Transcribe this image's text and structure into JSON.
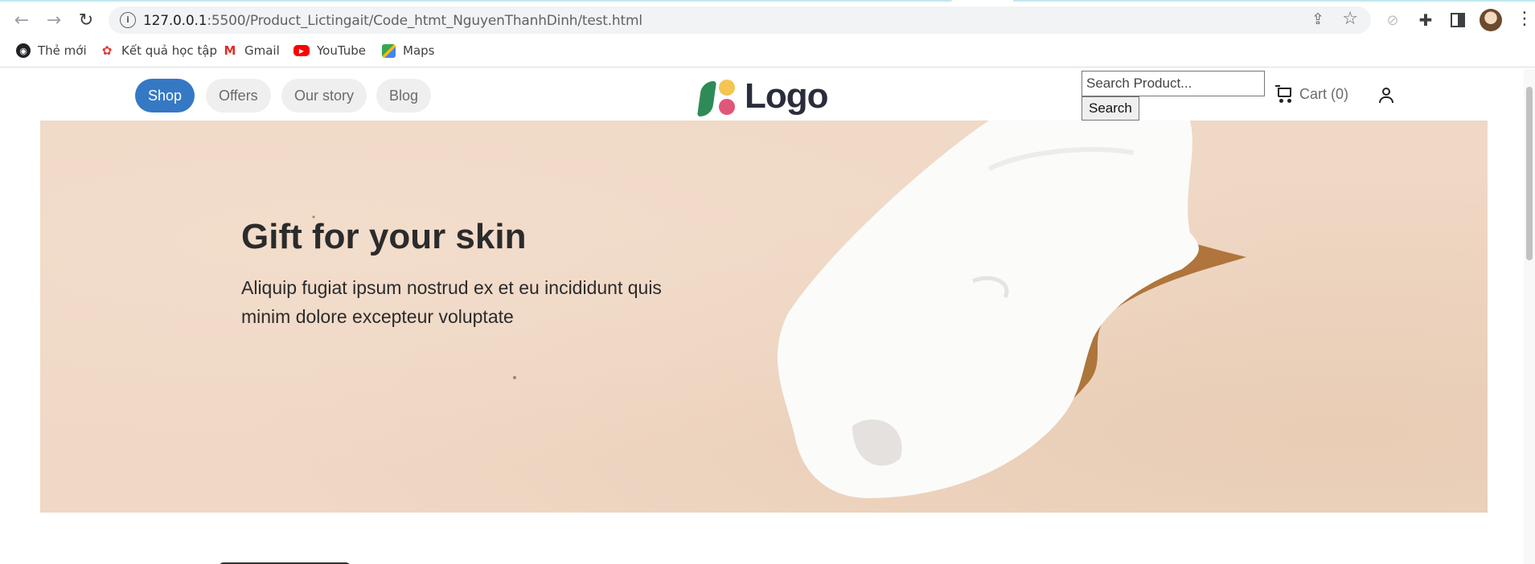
{
  "browser": {
    "url_host": "127.0.0.1",
    "url_rest": ":5500/Product_Lictingait/Code_htmt_NguyenThanhDinh/test.html"
  },
  "bookmarks": [
    {
      "label": "Thẻ mới",
      "icon": "globe-icon"
    },
    {
      "label": "Kết quả học tập",
      "icon": "school-logo-icon"
    },
    {
      "label": "Gmail",
      "icon": "gmail-icon"
    },
    {
      "label": "YouTube",
      "icon": "youtube-icon"
    },
    {
      "label": "Maps",
      "icon": "maps-icon"
    }
  ],
  "header": {
    "nav": [
      {
        "label": "Shop",
        "active": true
      },
      {
        "label": "Offers",
        "active": false
      },
      {
        "label": "Our story",
        "active": false
      },
      {
        "label": "Blog",
        "active": false
      }
    ],
    "logo_text": "Logo",
    "search_placeholder": "Search Product...",
    "search_button": "Search",
    "cart_label": "Cart (0)"
  },
  "hero": {
    "title": "Gift for your skin",
    "subtitle": "Aliquip fugiat ipsum nostrud ex et eu incididunt quis minim dolore excepteur voluptate"
  },
  "colors": {
    "accent": "#3578c4",
    "hero_bg": "#efd8c5",
    "logo_green": "#2e8b57",
    "logo_yellow": "#f4c552",
    "logo_pink": "#e0567a"
  }
}
